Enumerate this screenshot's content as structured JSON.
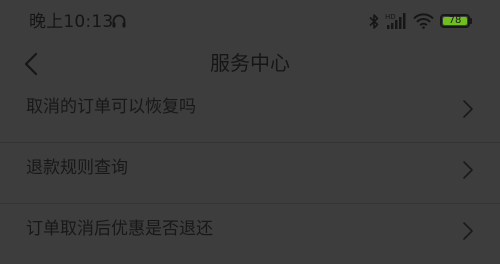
{
  "status_bar": {
    "time": "晚上10:13",
    "battery_level": "78",
    "icons": [
      "headset-icon",
      "bluetooth-icon",
      "signal-icon",
      "wifi-icon",
      "battery-icon"
    ]
  },
  "header": {
    "title": "服务中心",
    "back_icon": "chevron-left-icon"
  },
  "faq": {
    "items": [
      {
        "label": "取消的订单可以恢复吗"
      },
      {
        "label": "退款规则查询"
      },
      {
        "label": "订单取消后优惠是否退还"
      }
    ]
  },
  "colors": {
    "overlay_background": "#3d3d3d",
    "text": "#181818",
    "battery_fill": "#6fbf1f"
  }
}
